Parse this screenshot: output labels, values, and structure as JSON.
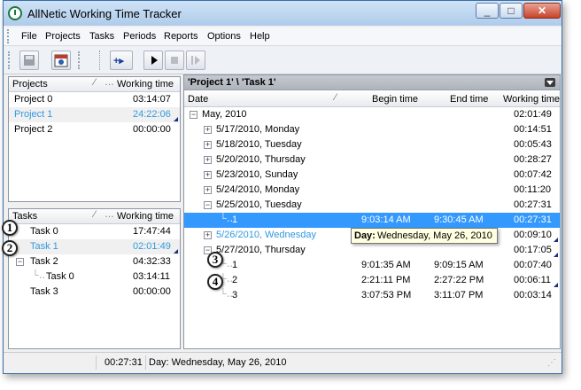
{
  "window": {
    "title": "AllNetic Working Time Tracker"
  },
  "menu": [
    "File",
    "Projects",
    "Tasks",
    "Periods",
    "Reports",
    "Options",
    "Help"
  ],
  "projects": {
    "header": {
      "name": "Projects",
      "time": "Working time"
    },
    "rows": [
      {
        "name": "Project 0",
        "time": "03:14:07"
      },
      {
        "name": "Project 1",
        "time": "24:22:06"
      },
      {
        "name": "Project 2",
        "time": "00:00:00"
      }
    ]
  },
  "tasks": {
    "header": {
      "name": "Tasks",
      "time": "Working time"
    },
    "rows": [
      {
        "name": "Task 0",
        "time": "17:47:44"
      },
      {
        "name": "Task 1",
        "time": "02:01:49"
      },
      {
        "name": "Task 2",
        "time": "04:32:33"
      },
      {
        "name": "Task 0",
        "time": "03:14:11"
      },
      {
        "name": "Task 3",
        "time": "00:00:00"
      }
    ]
  },
  "breadcrumb": "'Project 1' \\ 'Task 1'",
  "log": {
    "header": {
      "date": "Date",
      "begin": "Begin time",
      "end": "End time",
      "time": "Working time"
    },
    "rows": [
      {
        "date": "May, 2010",
        "begin": "",
        "end": "",
        "time": "02:01:49"
      },
      {
        "date": "5/17/2010, Monday",
        "begin": "",
        "end": "",
        "time": "00:14:51"
      },
      {
        "date": "5/18/2010, Tuesday",
        "begin": "",
        "end": "",
        "time": "00:05:43"
      },
      {
        "date": "5/20/2010, Thursday",
        "begin": "",
        "end": "",
        "time": "00:28:27"
      },
      {
        "date": "5/23/2010, Sunday",
        "begin": "",
        "end": "",
        "time": "00:07:42"
      },
      {
        "date": "5/24/2010, Monday",
        "begin": "",
        "end": "",
        "time": "00:11:20"
      },
      {
        "date": "5/25/2010, Tuesday",
        "begin": "",
        "end": "",
        "time": "00:27:31"
      },
      {
        "date": "1",
        "begin": "9:03:14 AM",
        "end": "9:30:45 AM",
        "time": "00:27:31"
      },
      {
        "date": "5/26/2010, Wednesday",
        "begin": "",
        "end": "",
        "time": "00:09:10"
      },
      {
        "date": "5/27/2010, Thursday",
        "begin": "",
        "end": "",
        "time": "00:17:05"
      },
      {
        "date": "1",
        "begin": "9:01:35 AM",
        "end": "9:09:15 AM",
        "time": "00:07:40"
      },
      {
        "date": "2",
        "begin": "2:21:11 PM",
        "end": "2:27:22 PM",
        "time": "00:06:11"
      },
      {
        "date": "3",
        "begin": "3:07:53 PM",
        "end": "3:11:07 PM",
        "time": "00:03:14"
      }
    ]
  },
  "tooltip": {
    "label": "Day:",
    "value": "Wednesday, May 26, 2010"
  },
  "status": {
    "time": "00:27:31",
    "text": "Day: Wednesday, May 26, 2010"
  },
  "callouts": [
    "1",
    "2",
    "3",
    "4"
  ],
  "colors": {
    "selection": "#3399ff",
    "selected_text": "#3399dd"
  }
}
